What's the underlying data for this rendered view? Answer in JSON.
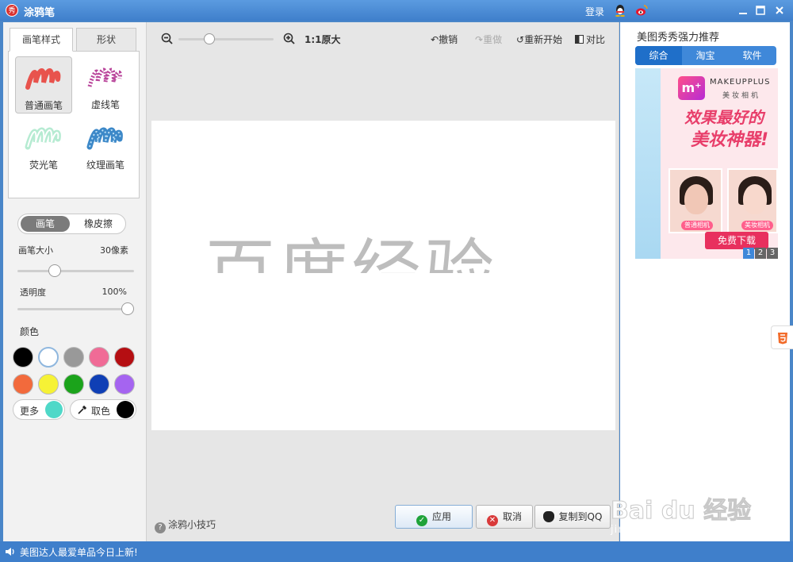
{
  "window": {
    "title": "涂鸦笔",
    "app_logo_text": "秀",
    "login": "登录"
  },
  "left": {
    "tabs": [
      {
        "label": "画笔样式",
        "active": true
      },
      {
        "label": "形状",
        "active": false
      }
    ],
    "brushes": [
      {
        "label": "普通画笔",
        "selected": true,
        "color": "#e8534d"
      },
      {
        "label": "虚线笔",
        "selected": false,
        "color": "#b9469b"
      },
      {
        "label": "荧光笔",
        "selected": false,
        "color": "#9ee0c0"
      },
      {
        "label": "纹理画笔",
        "selected": false,
        "color": "#3c88c8"
      }
    ],
    "mode_toggle": {
      "active": "画笔",
      "inactive": "橡皮擦"
    },
    "brush_size": {
      "label": "画笔大小",
      "value": "30像素",
      "level": 0.3
    },
    "opacity": {
      "label": "透明度",
      "value": "100%",
      "level": 1.0
    },
    "color_label": "颜色",
    "swatches": [
      "#000000",
      "#ffffff",
      "#999999",
      "#f06b96",
      "#b50e12",
      "#f26a3c",
      "#f6f235",
      "#1ba31b",
      "#0f3fb5",
      "#a564f0"
    ],
    "selected_swatch": "#ffffff",
    "more": {
      "label": "更多",
      "color": "#4fd8c8"
    },
    "pick": {
      "label": "取色",
      "color": "#000000"
    }
  },
  "toolbar": {
    "zoom_level": 0.3,
    "ratio": "1:1原大",
    "undo": "撤销",
    "redo": "重做",
    "restart": "重新开始",
    "compare": "对比"
  },
  "canvas": {
    "text": "百度经验"
  },
  "footer": {
    "tips": "涂鸦小技巧",
    "apply": "应用",
    "cancel": "取消",
    "copy_qq": "复制到QQ"
  },
  "right": {
    "title": "美图秀秀强力推荐",
    "tabs": [
      {
        "label": "综合",
        "active": true
      },
      {
        "label": "淘宝",
        "active": false
      },
      {
        "label": "软件",
        "active": false
      }
    ],
    "ad": {
      "logo": "m⁺",
      "brand": "MAKEUPPLUS",
      "brand_sub": "美妆相机",
      "headline1": "效果最好的",
      "headline2": "美妆神器!",
      "tag_left": "普通相机",
      "tag_right": "美妆相机",
      "button": "免费下载",
      "pages": [
        "1",
        "2",
        "3"
      ],
      "active_page": "1"
    }
  },
  "status": {
    "text": "美图达人最爱单品今日上新!"
  },
  "watermark": {
    "text": "Bai du 经验",
    "url": "jingyan.baidu.com"
  }
}
